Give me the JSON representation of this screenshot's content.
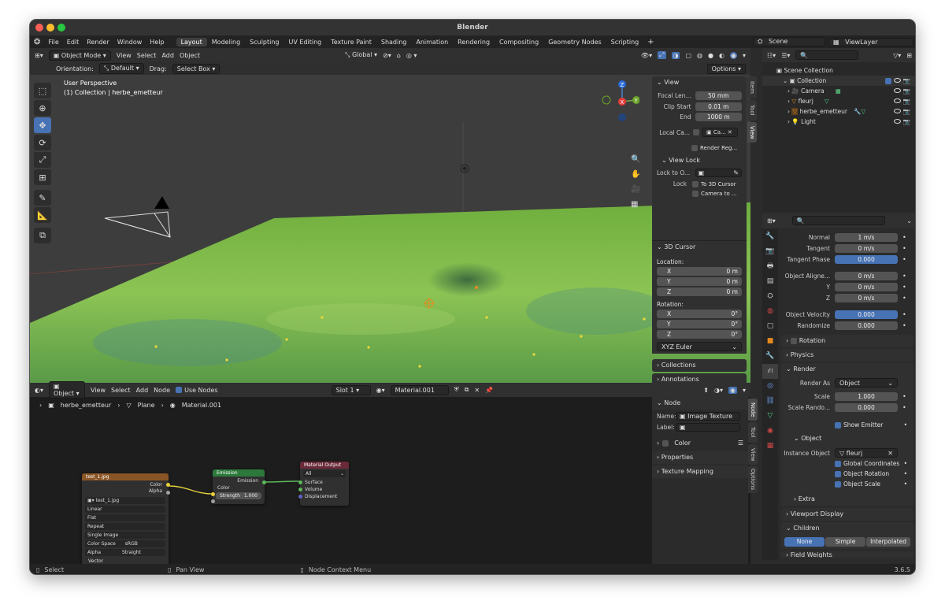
{
  "title": "Blender",
  "menu": [
    "File",
    "Edit",
    "Render",
    "Window",
    "Help"
  ],
  "workspaces": [
    "Layout",
    "Modeling",
    "Sculpting",
    "UV Editing",
    "Texture Paint",
    "Shading",
    "Animation",
    "Rendering",
    "Compositing",
    "Geometry Nodes",
    "Scripting"
  ],
  "active_workspace": "Layout",
  "scene": "Scene",
  "viewlayer": "ViewLayer",
  "viewport": {
    "mode": "Object Mode",
    "menus": [
      "View",
      "Select",
      "Add",
      "Object"
    ],
    "transform_space": "Global",
    "orientation_label": "Orientation:",
    "orientation": "Default",
    "drag_label": "Drag:",
    "drag": "Select Box",
    "options": "Options",
    "overlay_title": "User Perspective",
    "overlay_sub": "(1) Collection | herbe_emetteur",
    "gizmo": {
      "x": "X",
      "y": "Y",
      "z": "Z"
    }
  },
  "npanel": {
    "tabs": [
      "Item",
      "Tool",
      "View"
    ],
    "view_header": "View",
    "focal_label": "Focal Len...",
    "focal": "50 mm",
    "clip_start_label": "Clip Start",
    "clip_start": "0.01 m",
    "end_label": "End",
    "end": "1000 m",
    "local_cam_label": "Local Ca...",
    "local_cam_val": "Ca...",
    "render_region": "Render Reg...",
    "view_lock": "View Lock",
    "lock_to_label": "Lock to O...",
    "lock_label": "Lock",
    "to_3d_cursor": "To 3D Cursor",
    "camera_to": "Camera to ...",
    "cursor_header": "3D Cursor",
    "location_label": "Location:",
    "loc": [
      {
        "k": "X",
        "v": "0 m"
      },
      {
        "k": "Y",
        "v": "0 m"
      },
      {
        "k": "Z",
        "v": "0 m"
      }
    ],
    "rotation_label": "Rotation:",
    "rot": [
      {
        "k": "X",
        "v": "0°"
      },
      {
        "k": "Y",
        "v": "0°"
      },
      {
        "k": "Z",
        "v": "0°"
      }
    ],
    "rot_mode": "XYZ Euler",
    "collections": "Collections",
    "annotations": "Annotations"
  },
  "outliner": {
    "root": "Scene Collection",
    "items": [
      {
        "name": "Collection"
      },
      {
        "name": "Camera"
      },
      {
        "name": "fleurj"
      },
      {
        "name": "herbe_emetteur"
      },
      {
        "name": "Light"
      }
    ]
  },
  "props": {
    "rows1": [
      {
        "k": "Normal",
        "v": "1 m/s"
      },
      {
        "k": "Tangent",
        "v": "0 m/s"
      },
      {
        "k": "Tangent Phase",
        "v": "0.000"
      }
    ],
    "rows2": [
      {
        "k": "Object Aligne...",
        "v": "0 m/s"
      },
      {
        "k": "Y",
        "v": "0 m/s"
      },
      {
        "k": "Z",
        "v": "0 m/s"
      }
    ],
    "obj_velocity_label": "Object Velocity",
    "obj_velocity": "0.000",
    "randomize_label": "Randomize",
    "randomize": "0.000",
    "rotation": "Rotation",
    "physics": "Physics",
    "render": "Render",
    "render_as_label": "Render As",
    "render_as": "Object",
    "scale_label": "Scale",
    "scale": "1.000",
    "scale_rand_label": "Scale Rando...",
    "scale_rand": "0.000",
    "show_emitter": "Show Emitter",
    "object_sub": "Object",
    "instance_label": "Instance Object",
    "instance": "fleurj",
    "global_coords": "Global Coordinates",
    "object_rotation": "Object Rotation",
    "object_scale": "Object Scale",
    "extra": "Extra",
    "viewport_display": "Viewport Display",
    "children": "Children",
    "children_opts": [
      "None",
      "Simple",
      "Interpolated"
    ],
    "field_weights": "Field Weights"
  },
  "node_editor": {
    "object": "Object",
    "menus": [
      "View",
      "Select",
      "Add",
      "Node"
    ],
    "use_nodes": "Use Nodes",
    "slot": "Slot 1",
    "material": "Material.001",
    "breadcrumb": [
      "herbe_emetteur",
      "Plane",
      "Material.001"
    ],
    "img_node": {
      "title": "test_1.jpg",
      "out1": "Color",
      "out2": "Alpha",
      "image": "test_1.jpg",
      "interp": "Linear",
      "proj": "Flat",
      "ext": "Repeat",
      "source": "Single Image",
      "cs_label": "Color Space",
      "cs": "sRGB",
      "alpha_label": "Alpha",
      "alpha": "Straight",
      "vector": "Vector"
    },
    "emission_node": {
      "title": "Emission",
      "out": "Emission",
      "color": "Color",
      "strength_label": "Strength",
      "strength": "1.000"
    },
    "output_node": {
      "title": "Material Output",
      "target": "All",
      "surface": "Surface",
      "volume": "Volume",
      "displacement": "Displacement"
    }
  },
  "node_panel": {
    "tabs": [
      "Node",
      "Tool",
      "View",
      "Options"
    ],
    "header": "Node",
    "name_label": "Name:",
    "name": "Image Texture",
    "label_label": "Label:",
    "color": "Color",
    "properties": "Properties",
    "texture_mapping": "Texture Mapping"
  },
  "status": {
    "select": "Select",
    "pan": "Pan View",
    "context": "Node Context Menu",
    "version": "3.6.5"
  }
}
